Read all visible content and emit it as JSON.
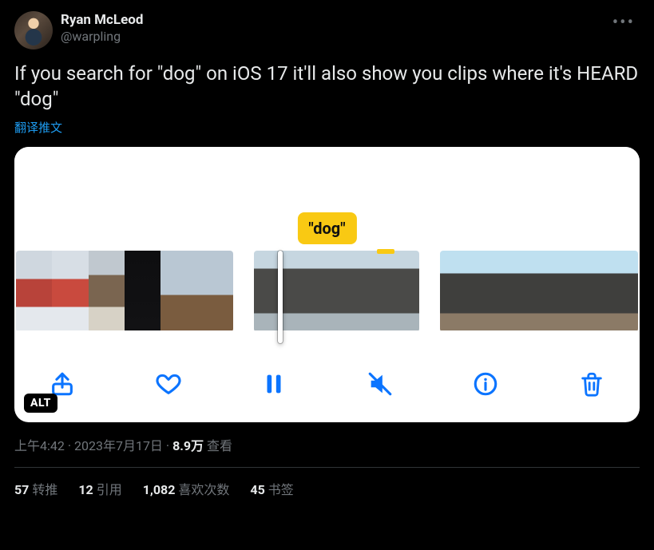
{
  "author": {
    "display_name": "Ryan McLeod",
    "handle": "@warpling"
  },
  "tweet_text": "If you search for \"dog\" on iOS 17 it'll also show you clips where it's HEARD \"dog\"",
  "translate_label": "翻译推文",
  "media": {
    "search_term": "\"dog\"",
    "alt_badge": "ALT",
    "controls": {
      "share": "share",
      "like": "like",
      "pause": "pause",
      "mute": "mute",
      "info": "info",
      "delete": "delete"
    }
  },
  "meta": {
    "time": "上午4:42",
    "date": "2023年7月17日",
    "separator": " · ",
    "views_number": "8.9万",
    "views_label": " 查看"
  },
  "stats": {
    "retweets": {
      "count": "57",
      "label": "转推"
    },
    "quotes": {
      "count": "12",
      "label": "引用"
    },
    "likes": {
      "count": "1,082",
      "label": "喜欢次数"
    },
    "bookmarks": {
      "count": "45",
      "label": "书签"
    }
  }
}
